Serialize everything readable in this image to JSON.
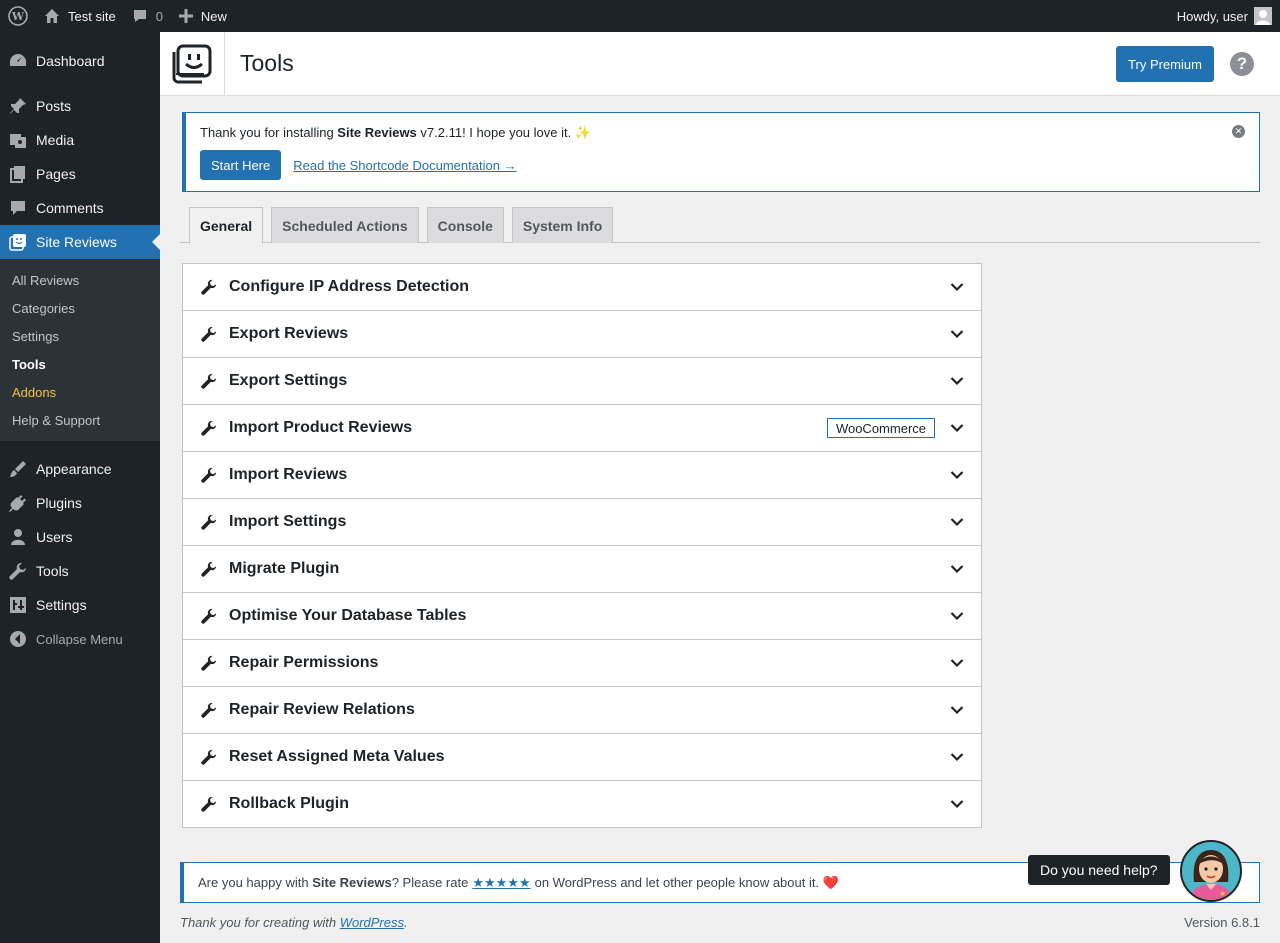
{
  "adminbar": {
    "site_name": "Test site",
    "comments_count": "0",
    "new_label": "New",
    "greeting": "Howdy, user"
  },
  "sidebar": {
    "items": [
      {
        "label": "Dashboard",
        "icon": "dashboard-icon"
      },
      {
        "label": "Posts",
        "icon": "pin-icon"
      },
      {
        "label": "Media",
        "icon": "media-icon"
      },
      {
        "label": "Pages",
        "icon": "pages-icon"
      },
      {
        "label": "Comments",
        "icon": "comment-icon"
      },
      {
        "label": "Site Reviews",
        "icon": "site-reviews-icon"
      }
    ],
    "submenu": [
      "All Reviews",
      "Categories",
      "Settings",
      "Tools",
      "Addons",
      "Help & Support"
    ],
    "items_bottom": [
      {
        "label": "Appearance",
        "icon": "brush-icon"
      },
      {
        "label": "Plugins",
        "icon": "plug-icon"
      },
      {
        "label": "Users",
        "icon": "user-icon"
      },
      {
        "label": "Tools",
        "icon": "wrench-icon"
      },
      {
        "label": "Settings",
        "icon": "settings-icon"
      }
    ],
    "collapse_label": "Collapse Menu"
  },
  "header": {
    "title": "Tools",
    "try_premium": "Try Premium",
    "help_label": "?"
  },
  "notice": {
    "text_before": "Thank you for installing ",
    "plugin_name": "Site Reviews",
    "text_after": " v7.2.11! I hope you love it. ",
    "sparkle": "✨",
    "start_here": "Start Here",
    "doc_link": "Read the Shortcode Documentation →"
  },
  "tabs": [
    "General",
    "Scheduled Actions",
    "Console",
    "System Info"
  ],
  "tools": [
    {
      "title": "Configure IP Address Detection",
      "badge": ""
    },
    {
      "title": "Export Reviews",
      "badge": ""
    },
    {
      "title": "Export Settings",
      "badge": ""
    },
    {
      "title": "Import Product Reviews",
      "badge": "WooCommerce"
    },
    {
      "title": "Import Reviews",
      "badge": ""
    },
    {
      "title": "Import Settings",
      "badge": ""
    },
    {
      "title": "Migrate Plugin",
      "badge": ""
    },
    {
      "title": "Optimise Your Database Tables",
      "badge": ""
    },
    {
      "title": "Repair Permissions",
      "badge": ""
    },
    {
      "title": "Repair Review Relations",
      "badge": ""
    },
    {
      "title": "Reset Assigned Meta Values",
      "badge": ""
    },
    {
      "title": "Rollback Plugin",
      "badge": ""
    }
  ],
  "rate_notice": {
    "before": "Are you happy with ",
    "plugin_name": "Site Reviews",
    "middle": "? Please rate",
    "stars": "★★★★★",
    "after": "on WordPress and let other people know about it.",
    "heart": "❤️"
  },
  "footer": {
    "thanks_before": "Thank you for creating with ",
    "wordpress": "WordPress",
    "thanks_after": ".",
    "version": "Version 6.8.1"
  },
  "help_widget": {
    "tooltip": "Do you need help?"
  },
  "colors": {
    "accent": "#2271b1",
    "sidebar_bg": "#1d2327",
    "addons": "#f0c33c"
  }
}
